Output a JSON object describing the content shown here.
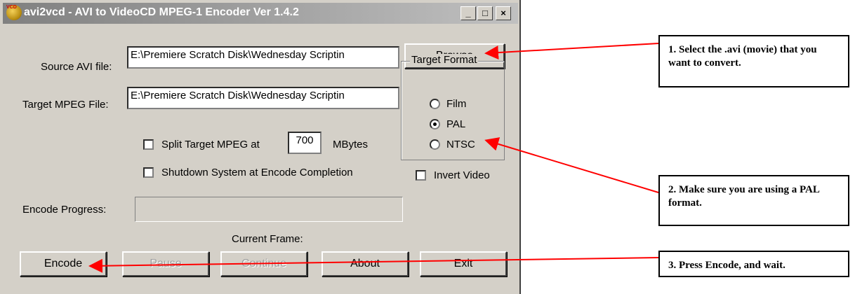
{
  "window": {
    "title": "avi2vcd - AVI to VideoCD MPEG-1 Encoder Ver 1.4.2",
    "minimize": "_",
    "maximize": "□",
    "close": "×"
  },
  "source": {
    "label": "Source AVI file:",
    "value": "E:\\Premiere Scratch Disk\\Wednesday Scriptin"
  },
  "target": {
    "label": "Target MPEG File:",
    "value": "E:\\Premiere Scratch Disk\\Wednesday Scriptin"
  },
  "browse_label": "Browse",
  "format": {
    "title": "Target Format",
    "options": [
      {
        "label": "Film",
        "selected": false
      },
      {
        "label": "PAL",
        "selected": true
      },
      {
        "label": "NTSC",
        "selected": false
      }
    ]
  },
  "split": {
    "label_before": "Split Target MPEG at",
    "value": "700",
    "label_after": "MBytes",
    "checked": false
  },
  "shutdown": {
    "label": "Shutdown System at Encode Completion",
    "checked": false
  },
  "invert": {
    "label": "Invert Video",
    "checked": false
  },
  "progress": {
    "label": "Encode Progress:",
    "value": 0
  },
  "current_frame_label": "Current Frame:",
  "buttons": {
    "encode": "Encode",
    "pause": "Pause",
    "continue": "Continue",
    "about": "About",
    "exit": "Exit"
  },
  "notes": {
    "n1": "1.  Select the .avi (movie) that you want to convert.",
    "n2": "2.  Make sure you are using a PAL format.",
    "n3": "3.  Press Encode, and wait."
  },
  "colors": {
    "annotation_arrow": "#ff0000",
    "window_bg": "#d4d0c8"
  }
}
